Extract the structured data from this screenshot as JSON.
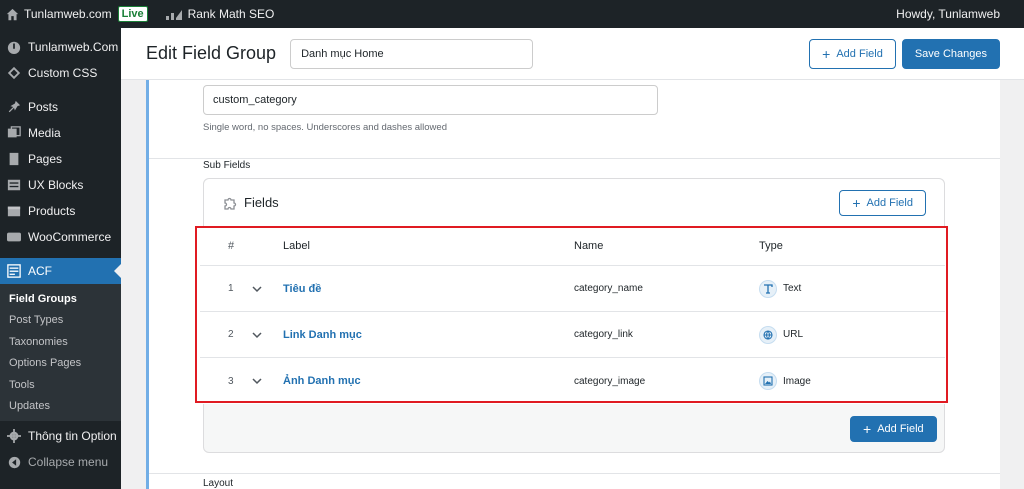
{
  "adminbar": {
    "site_name": "Tunlamweb.com",
    "live_badge": "Live",
    "rank_math": "Rank Math SEO",
    "howdy": "Howdy, Tunlamweb"
  },
  "sidebar": {
    "items": [
      {
        "label": "Tunlamweb.Com",
        "icon": "dashboard-icon"
      },
      {
        "label": "Custom CSS",
        "icon": "css-icon"
      },
      {
        "label": "Posts",
        "icon": "pin-icon"
      },
      {
        "label": "Media",
        "icon": "media-icon"
      },
      {
        "label": "Pages",
        "icon": "pages-icon"
      },
      {
        "label": "UX Blocks",
        "icon": "blocks-icon"
      },
      {
        "label": "Products",
        "icon": "products-icon"
      },
      {
        "label": "WooCommerce",
        "icon": "woo-icon"
      },
      {
        "label": "ACF",
        "icon": "acf-icon"
      }
    ],
    "submenu": [
      "Field Groups",
      "Post Types",
      "Taxonomies",
      "Options Pages",
      "Tools",
      "Updates"
    ],
    "option": "Thông tin Option",
    "collapse": "Collapse menu"
  },
  "header": {
    "title": "Edit Field Group",
    "group_name": "Danh mục Home",
    "add_field": "Add Field",
    "save": "Save Changes"
  },
  "field": {
    "name_value": "custom_category",
    "hint": "Single word, no spaces. Underscores and dashes allowed",
    "sub_fields_label": "Sub Fields"
  },
  "subfields": {
    "title": "Fields",
    "add_field": "Add Field",
    "columns": [
      "#",
      "Label",
      "Name",
      "Type"
    ],
    "rows": [
      {
        "num": "1",
        "label": "Tiêu đề",
        "name": "category_name",
        "type": "Text",
        "icon": "text-type-icon"
      },
      {
        "num": "2",
        "label": "Link Danh mục",
        "name": "category_link",
        "type": "URL",
        "icon": "url-type-icon"
      },
      {
        "num": "3",
        "label": "Ảnh Danh mục",
        "name": "category_image",
        "type": "Image",
        "icon": "image-type-icon"
      }
    ],
    "bottom_add_field": "Add Field"
  },
  "layout_label": "Layout",
  "colors": {
    "accent": "#2271b1",
    "sidebar": "#1d2327",
    "highlight": "#e01b22"
  }
}
